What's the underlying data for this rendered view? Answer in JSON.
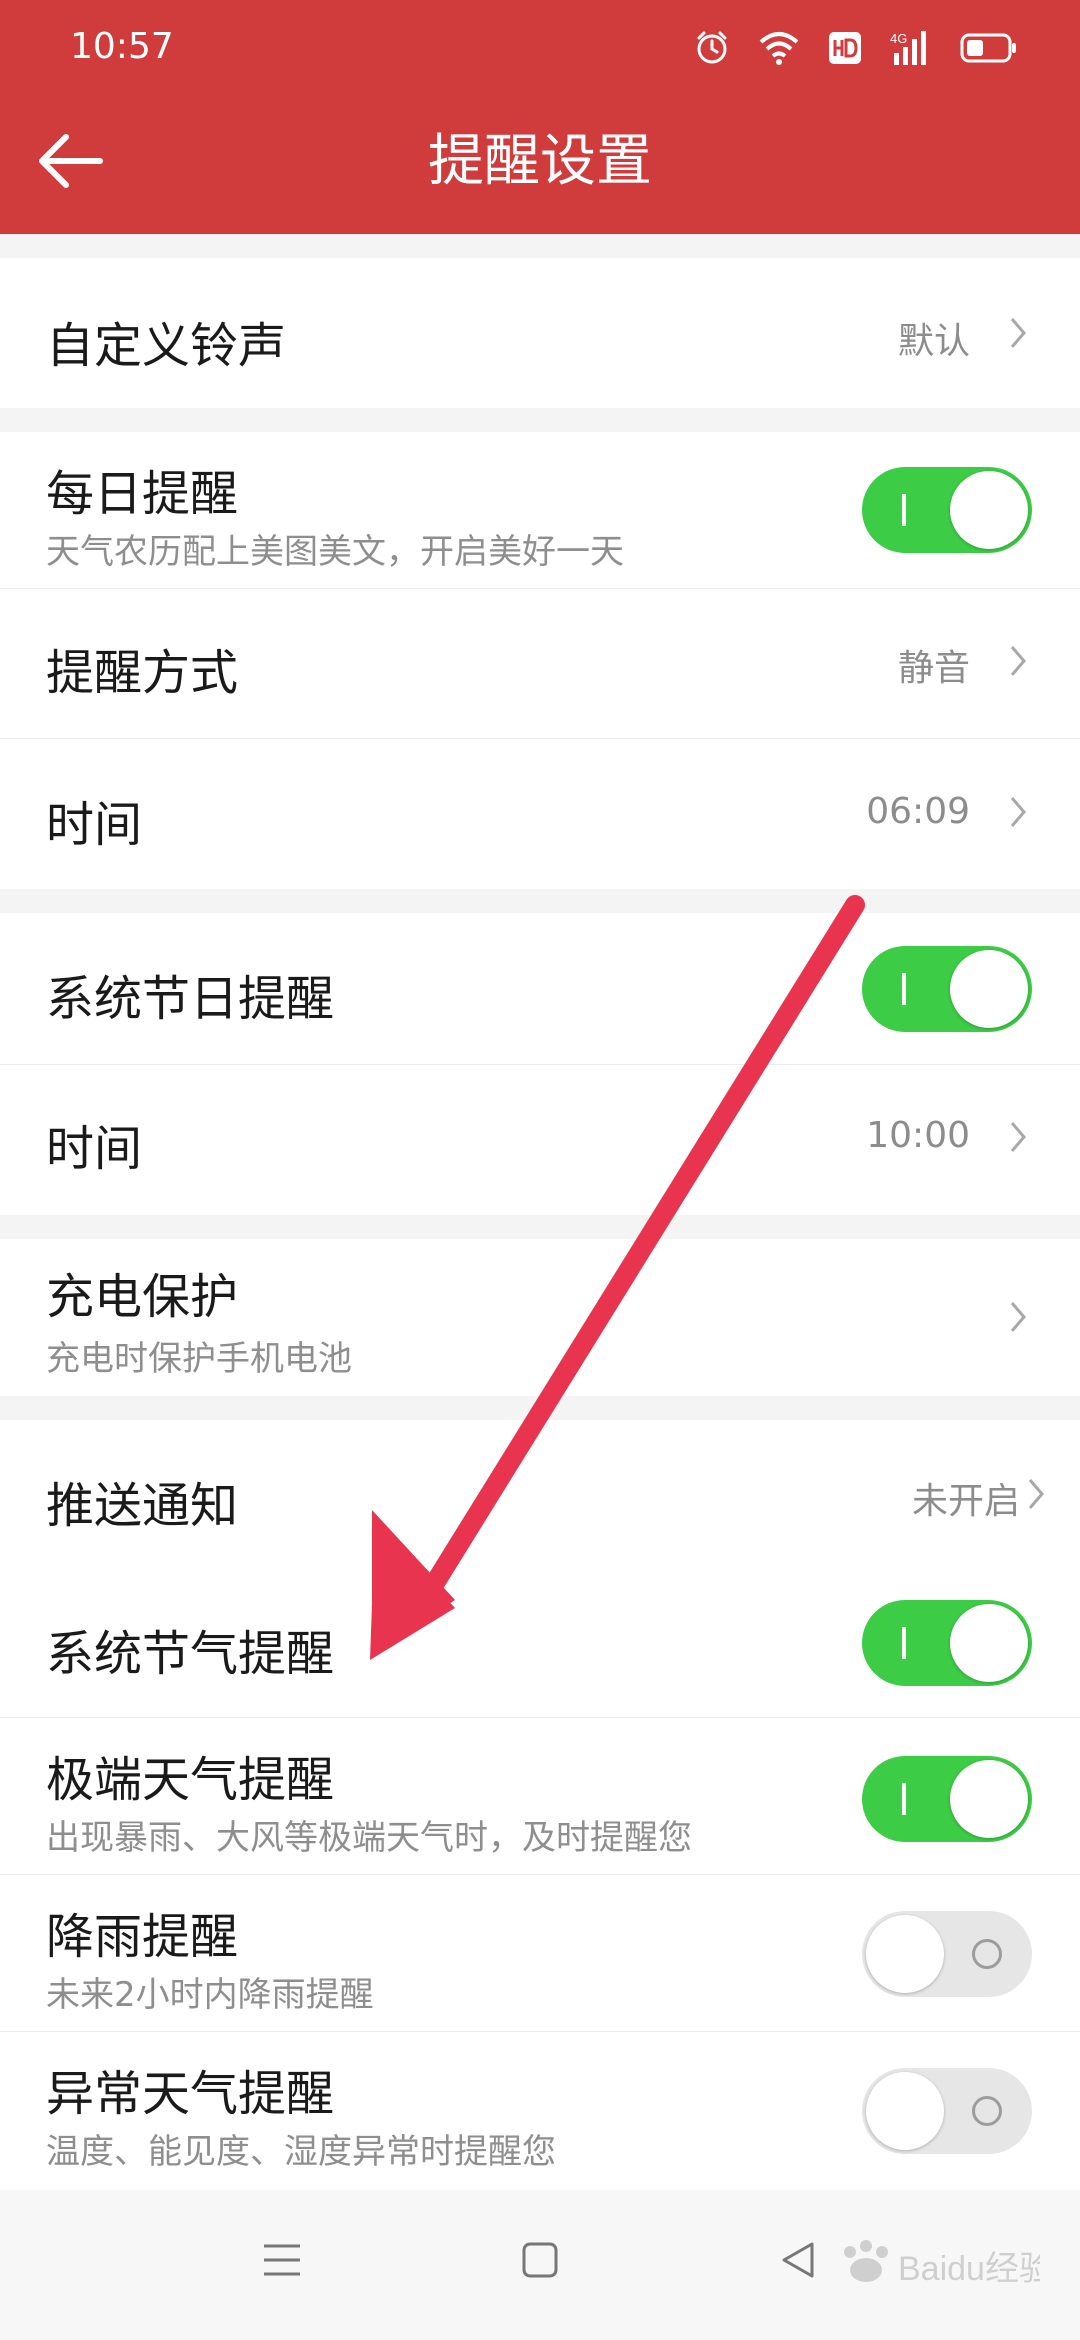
{
  "status_bar": {
    "time": "10:57",
    "icons": [
      "alarm-icon",
      "wifi-icon",
      "hd-icon",
      "signal-4g-icon",
      "battery-icon"
    ]
  },
  "header": {
    "title": "提醒设置",
    "back_icon": "back-arrow-icon",
    "color": "#d03c3c"
  },
  "items": {
    "custom_ringtone": {
      "label": "自定义铃声",
      "value": "默认"
    },
    "daily_reminder": {
      "label": "每日提醒",
      "subtitle": "天气农历配上美图美文，开启美好一天",
      "toggle": true
    },
    "reminder_method": {
      "label": "提醒方式",
      "value": "静音"
    },
    "daily_time": {
      "label": "时间",
      "value": "06:09"
    },
    "holiday_reminder": {
      "label": "系统节日提醒",
      "toggle": true
    },
    "holiday_time": {
      "label": "时间",
      "value": "10:00"
    },
    "charging_protect": {
      "label": "充电保护",
      "subtitle": "充电时保护手机电池"
    },
    "push_notify": {
      "label": "推送通知",
      "value": "未开启"
    },
    "solar_term": {
      "label": "系统节气提醒",
      "toggle": true
    },
    "extreme_weather": {
      "label": "极端天气提醒",
      "subtitle": "出现暴雨、大风等极端天气时，及时提醒您",
      "toggle": true
    },
    "rain_reminder": {
      "label": "降雨提醒",
      "subtitle": "未来2小时内降雨提醒",
      "toggle": false
    },
    "abnormal_weather": {
      "label": "异常天气提醒",
      "subtitle": "温度、能见度、湿度异常时提醒您",
      "toggle": false
    }
  },
  "nav_bar": {
    "icons": [
      "menu-icon",
      "home-icon",
      "back-triangle-icon"
    ]
  },
  "colors": {
    "toggle_on": "#3ccc46",
    "toggle_off": "#e6e6e6",
    "annotation_arrow": "#e8344f"
  },
  "watermark": "Baidu经验"
}
